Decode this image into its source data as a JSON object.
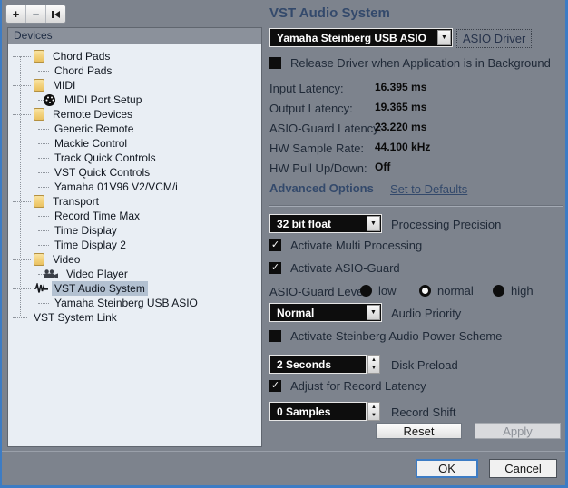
{
  "colors": {
    "accent_border": "#3d7cc4",
    "panel_bg": "#7d838d",
    "list_bg": "#e9eef4",
    "selection_bg": "#b3c1d1",
    "heading_text": "#33496b",
    "control_bg": "#0d0d0d"
  },
  "toolbar": {
    "add_label": "+",
    "remove_label": "−",
    "reset_icon": "skip-back-icon"
  },
  "devices_panel": {
    "header": "Devices",
    "tree": [
      {
        "label": "Chord Pads",
        "icon": "folder",
        "level": 1
      },
      {
        "label": "Chord Pads",
        "icon": null,
        "level": 2
      },
      {
        "label": "MIDI",
        "icon": "folder",
        "level": 1
      },
      {
        "label": "MIDI Port Setup",
        "icon": "midi",
        "level": 2
      },
      {
        "label": "Remote Devices",
        "icon": "folder",
        "level": 1
      },
      {
        "label": "Generic Remote",
        "icon": null,
        "level": 2
      },
      {
        "label": "Mackie Control",
        "icon": null,
        "level": 2
      },
      {
        "label": "Track Quick Controls",
        "icon": null,
        "level": 2
      },
      {
        "label": "VST Quick Controls",
        "icon": null,
        "level": 2
      },
      {
        "label": "Yamaha 01V96 V2/VCM/i",
        "icon": null,
        "level": 2
      },
      {
        "label": "Transport",
        "icon": "folder",
        "level": 1
      },
      {
        "label": "Record Time Max",
        "icon": null,
        "level": 2
      },
      {
        "label": "Time Display",
        "icon": null,
        "level": 2
      },
      {
        "label": "Time Display 2",
        "icon": null,
        "level": 2
      },
      {
        "label": "Video",
        "icon": "folder",
        "level": 1
      },
      {
        "label": "Video Player",
        "icon": "video",
        "level": 2
      },
      {
        "label": "VST Audio System",
        "icon": "wave",
        "level": 1,
        "selected": true
      },
      {
        "label": "Yamaha Steinberg USB ASIO",
        "icon": null,
        "level": 2
      },
      {
        "label": "VST System Link",
        "icon": null,
        "level": 0
      }
    ]
  },
  "main": {
    "title": "VST Audio System",
    "asio_driver": {
      "value": "Yamaha Steinberg USB ASIO",
      "label": "ASIO Driver"
    },
    "release_driver": {
      "label": "Release Driver when Application is in Background",
      "checked": false
    },
    "info_rows": [
      {
        "label": "Input Latency:",
        "value": "16.395 ms"
      },
      {
        "label": "Output Latency:",
        "value": "19.365 ms"
      },
      {
        "label": "ASIO-Guard Latency:",
        "value": "23.220 ms"
      },
      {
        "label": "HW Sample Rate:",
        "value": "44.100 kHz"
      },
      {
        "label": "HW Pull Up/Down:",
        "value": "Off"
      }
    ],
    "advanced_options_label": "Advanced Options",
    "set_to_defaults_label": "Set to Defaults",
    "processing_precision": {
      "value": "32 bit float",
      "label": "Processing Precision"
    },
    "activate_multi_processing": {
      "label": "Activate Multi Processing",
      "checked": true
    },
    "activate_asio_guard": {
      "label": "Activate ASIO-Guard",
      "checked": true
    },
    "asio_guard_level": {
      "label": "ASIO-Guard Level:",
      "options": [
        "low",
        "normal",
        "high"
      ],
      "selected": "normal"
    },
    "audio_priority": {
      "value": "Normal",
      "label": "Audio Priority"
    },
    "power_scheme": {
      "label": "Activate Steinberg Audio Power Scheme",
      "checked": false
    },
    "disk_preload": {
      "value": "2 Seconds",
      "label": "Disk Preload"
    },
    "adjust_record_latency": {
      "label": "Adjust for Record Latency",
      "checked": true
    },
    "record_shift": {
      "value": "0 Samples",
      "label": "Record Shift"
    },
    "reset_label": "Reset",
    "apply_label": "Apply"
  },
  "footer": {
    "ok_label": "OK",
    "cancel_label": "Cancel"
  }
}
